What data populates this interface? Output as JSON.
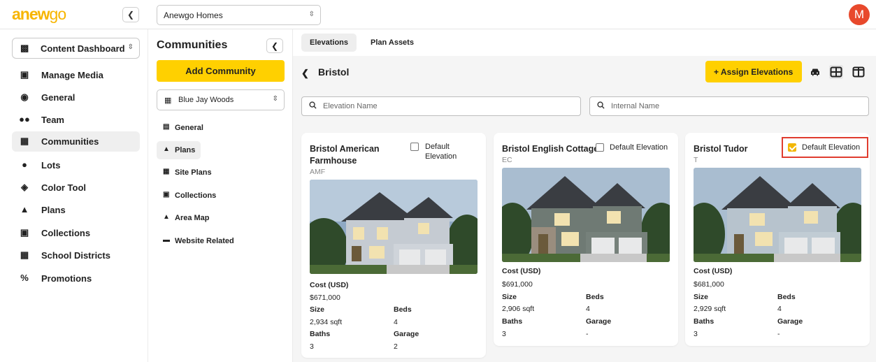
{
  "brand": {
    "logo_text": "anew",
    "logo_text_b": "go",
    "accent": "#ffd000",
    "logo_color": "#f7b500"
  },
  "topbar": {
    "collapse_icon": "chevron-left-icon",
    "org_select": "Anewgo Homes",
    "avatar_letter": "M",
    "avatar_color": "#e8492c"
  },
  "sidebar": {
    "dashboard_select": "Content Dashboard",
    "items": [
      {
        "label": "Manage Media",
        "icon": "media-icon"
      },
      {
        "label": "General",
        "icon": "globe-icon"
      },
      {
        "label": "Team",
        "icon": "team-icon"
      },
      {
        "label": "Communities",
        "icon": "communities-icon"
      },
      {
        "label": "Lots",
        "icon": "map-pin-icon"
      },
      {
        "label": "Color Tool",
        "icon": "paint-bucket-icon"
      },
      {
        "label": "Plans",
        "icon": "home-icon"
      },
      {
        "label": "Collections",
        "icon": "collections-icon"
      },
      {
        "label": "School Districts",
        "icon": "school-icon"
      },
      {
        "label": "Promotions",
        "icon": "percent-icon"
      }
    ]
  },
  "communities_panel": {
    "title": "Communities",
    "add_label": "Add Community",
    "community_select": "Blue Jay Woods",
    "items": [
      {
        "label": "General",
        "icon": "list-icon"
      },
      {
        "label": "Plans",
        "icon": "home-icon"
      },
      {
        "label": "Site Plans",
        "icon": "map-icon"
      },
      {
        "label": "Collections",
        "icon": "collections-icon"
      },
      {
        "label": "Area Map",
        "icon": "area-map-icon"
      },
      {
        "label": "Website Related",
        "icon": "browser-icon"
      }
    ]
  },
  "main": {
    "tabs": [
      {
        "label": "Elevations"
      },
      {
        "label": "Plan Assets"
      }
    ],
    "title": "Bristol",
    "assign_label": "+ Assign Elevations",
    "search_elevation_placeholder": "Elevation Name",
    "search_internal_placeholder": "Internal Name",
    "cards": [
      {
        "name": "Bristol American Farmhouse",
        "code": "AMF",
        "default_label": "Default Elevation",
        "default_checked": false,
        "cost_label": "Cost (USD)",
        "cost": "$671,000",
        "size_label": "Size",
        "size": "2,934 sqft",
        "beds_label": "Beds",
        "beds": "4",
        "baths_label": "Baths",
        "baths": "3",
        "garage_label": "Garage",
        "garage": "2"
      },
      {
        "name": "Bristol English Cottage",
        "code": "EC",
        "default_label": "Default Elevation",
        "default_checked": false,
        "cost_label": "Cost (USD)",
        "cost": "$691,000",
        "size_label": "Size",
        "size": "2,906 sqft",
        "beds_label": "Beds",
        "beds": "4",
        "baths_label": "Baths",
        "baths": "3",
        "garage_label": "Garage",
        "garage": "-"
      },
      {
        "name": "Bristol Tudor",
        "code": "T",
        "default_label": "Default Elevation",
        "default_checked": true,
        "cost_label": "Cost (USD)",
        "cost": "$681,000",
        "size_label": "Size",
        "size": "2,929 sqft",
        "beds_label": "Beds",
        "beds": "4",
        "baths_label": "Baths",
        "baths": "3",
        "garage_label": "Garage",
        "garage": "-"
      }
    ]
  }
}
